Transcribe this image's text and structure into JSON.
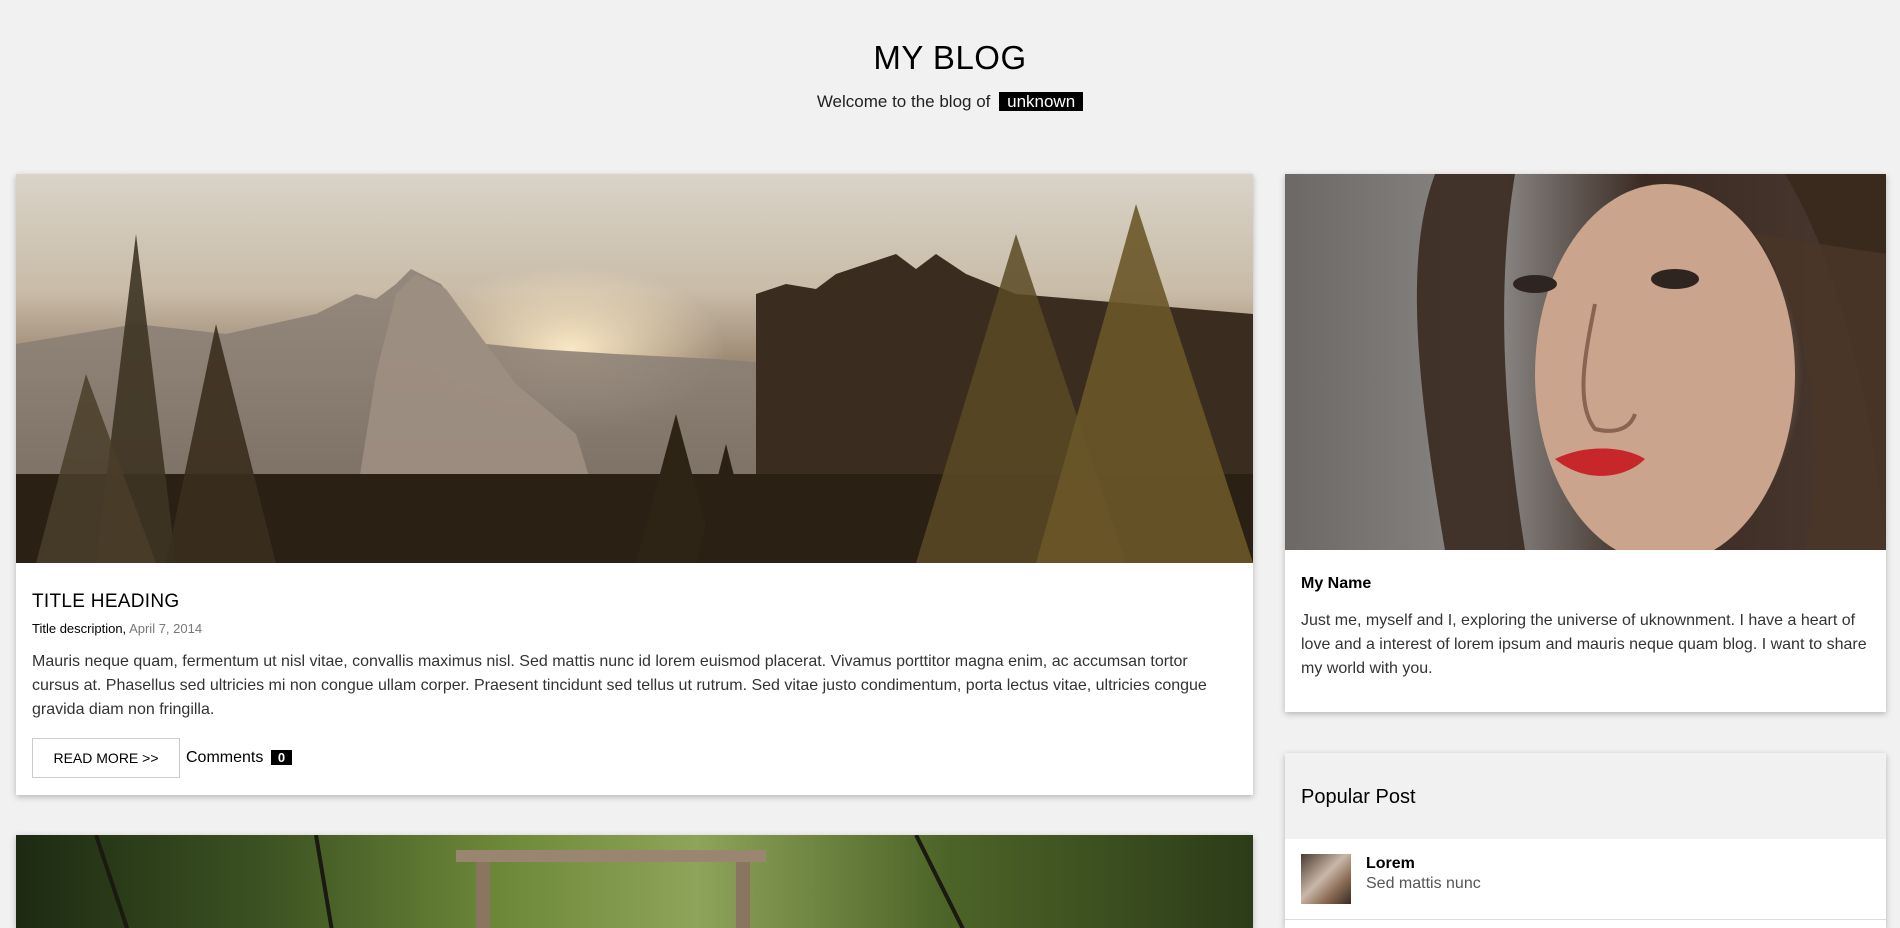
{
  "header": {
    "title": "MY BLOG",
    "tagline": "Welcome to the blog of",
    "author_badge": "unknown"
  },
  "post": {
    "image_alt": "mountain-sunset-forest",
    "title": "TITLE HEADING",
    "description": "Title description,",
    "date": "April 7, 2014",
    "body": "Mauris neque quam, fermentum ut nisl vitae, convallis maximus nisl. Sed mattis nunc id lorem euismod placerat. Vivamus porttitor magna enim, ac accumsan tortor cursus at. Phasellus sed ultricies mi non congue ullam corper. Praesent tincidunt sed tellus ut rutrum. Sed vitae justo condimentum, porta lectus vitae, ultricies congue gravida diam non fringilla.",
    "read_more_label": "READ MORE >>",
    "comments_label": "Comments",
    "comments_count": "0"
  },
  "profile": {
    "name": "My Name",
    "bio": "Just me, myself and I, exploring the universe of uknownment. I have a heart of love and a interest of lorem ipsum and mauris neque quam blog. I want to share my world with you."
  },
  "popular": {
    "title": "Popular Post",
    "items": [
      {
        "title": "Lorem",
        "subtitle": "Sed mattis nunc"
      }
    ]
  },
  "colors": {
    "background": "#f1f1f1",
    "card": "#ffffff",
    "badge": "#000000"
  }
}
